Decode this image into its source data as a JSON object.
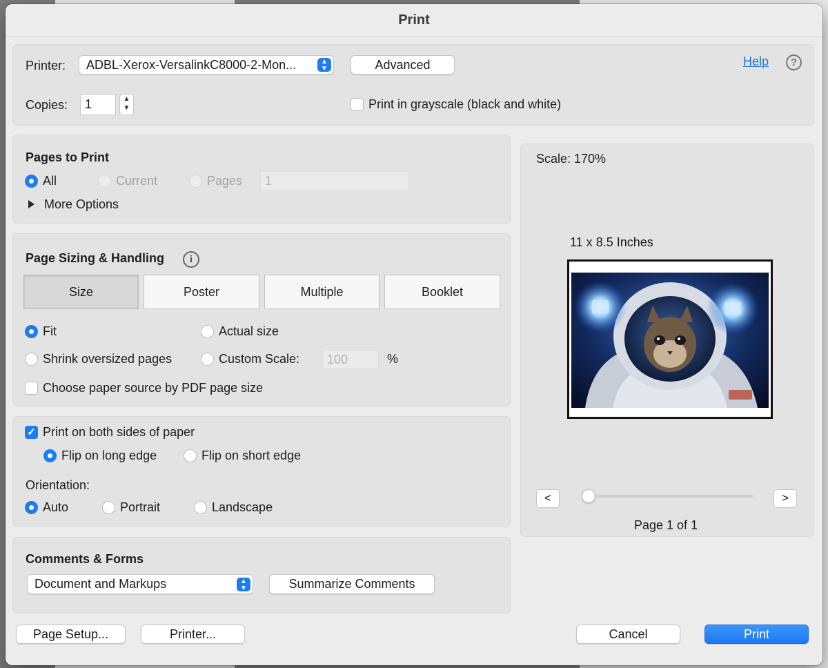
{
  "dialog": {
    "title": "Print"
  },
  "printer": {
    "label": "Printer:",
    "selected": "ADBL-Xerox-VersalinkC8000-2-Mon...",
    "advanced_label": "Advanced",
    "help_label": "Help",
    "help_icon": "question-circle-icon"
  },
  "copies": {
    "label": "Copies:",
    "value": "1"
  },
  "grayscale": {
    "label": "Print in grayscale (black and white)",
    "checked": false
  },
  "pages_to_print": {
    "heading": "Pages to Print",
    "all_label": "All",
    "current_label": "Current",
    "pages_label": "Pages",
    "pages_value": "1",
    "selected": "All",
    "more_options_label": "More Options"
  },
  "sizing": {
    "heading": "Page Sizing & Handling",
    "info_icon": "info-circle-icon",
    "tabs": [
      "Size",
      "Poster",
      "Multiple",
      "Booklet"
    ],
    "selected_tab": "Size",
    "fit_label": "Fit",
    "actual_size_label": "Actual size",
    "shrink_label": "Shrink oversized pages",
    "custom_scale_label": "Custom Scale:",
    "custom_scale_value": "100",
    "percent_label": "%",
    "selected_option": "Fit",
    "paper_source_label": "Choose paper source by PDF page size",
    "paper_source_checked": false
  },
  "duplex": {
    "both_sides_label": "Print on both sides of paper",
    "both_sides_checked": true,
    "long_edge_label": "Flip on long edge",
    "short_edge_label": "Flip on short edge",
    "selected": "Flip on long edge"
  },
  "orientation": {
    "label": "Orientation:",
    "auto_label": "Auto",
    "portrait_label": "Portrait",
    "landscape_label": "Landscape",
    "selected": "Auto"
  },
  "comments": {
    "heading": "Comments & Forms",
    "selected": "Document and Markups",
    "summarize_label": "Summarize Comments"
  },
  "preview": {
    "scale_text": "Scale: 170%",
    "paper_size": "11 x 8.5 Inches",
    "prev_label": "<",
    "next_label": ">",
    "page_indicator": "Page 1 of 1",
    "slider_position": 0
  },
  "footer": {
    "page_setup_label": "Page Setup...",
    "printer_label": "Printer...",
    "cancel_label": "Cancel",
    "print_label": "Print"
  },
  "colors": {
    "accent": "#1e7cf3",
    "link": "#1e6fdc"
  }
}
